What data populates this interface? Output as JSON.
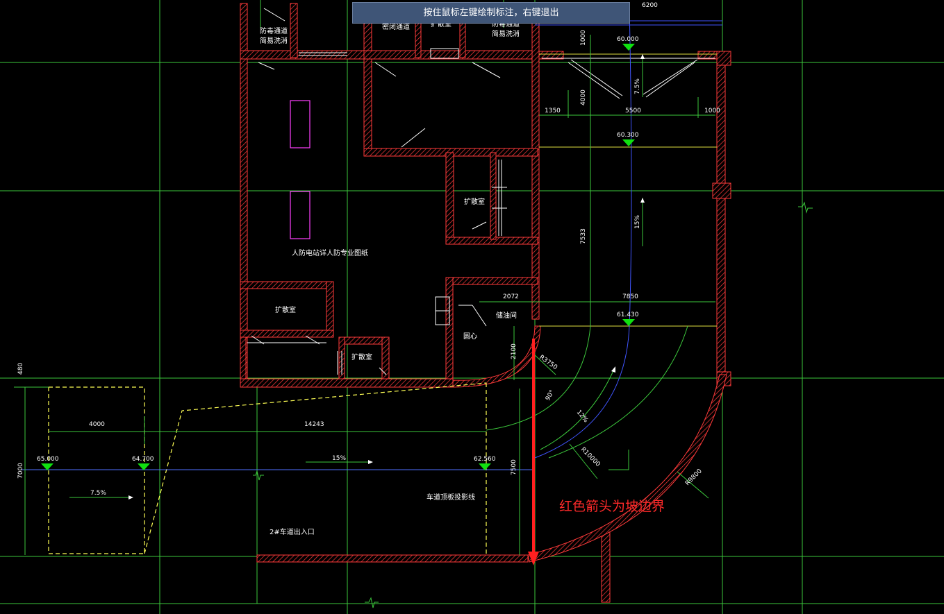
{
  "tooltip": "按住鼠标左键绘制标注，右键退出",
  "rooms": {
    "r1a": "防毒通道",
    "r1b": "简易洗消",
    "r2": "密闭通道",
    "r3": "扩散室",
    "r4a": "防毒通道",
    "r4b": "简易洗消",
    "r5": "扩散室",
    "r6": "人防电站详人防专业图纸",
    "r7": "扩散室",
    "r8": "扩散室",
    "r9": "储油间",
    "r10": "圆心",
    "r11": "车道顶板投影线",
    "r12": "2#车道出入口"
  },
  "dims": {
    "d6200": "6200",
    "d1000a": "1000",
    "d4000": "4000",
    "d1350": "1350",
    "d5500": "5500",
    "d1000b": "1000",
    "d7533": "7533",
    "d2072": "2072",
    "d7850": "7850",
    "d2100": "2100",
    "r3750": "R3750",
    "a90": "90°",
    "r10000": "R10000",
    "r9800": "R9800",
    "d480": "480",
    "d7000": "7000",
    "d4000b": "4000",
    "d14243": "14243",
    "d7500": "7500"
  },
  "slopes": {
    "s1": "7.5%",
    "s2": "15%",
    "s3": "12%",
    "s4": "15%",
    "s5": "7.5%"
  },
  "levels": {
    "l1": "60.000",
    "l2": "60.300",
    "l3": "61.430",
    "l4": "65.000",
    "l5": "64.700",
    "l6": "62.560"
  },
  "annotation": "红色箭头为坡边界",
  "colors": {
    "grid": "#4aff4a",
    "wall": "#ff3a3a",
    "text": "#ffffff",
    "dashed": "#ffff55",
    "arrow": "#ff2020",
    "level": "#10e010",
    "axis": "#4055ff",
    "pink": "#ff40ff"
  }
}
